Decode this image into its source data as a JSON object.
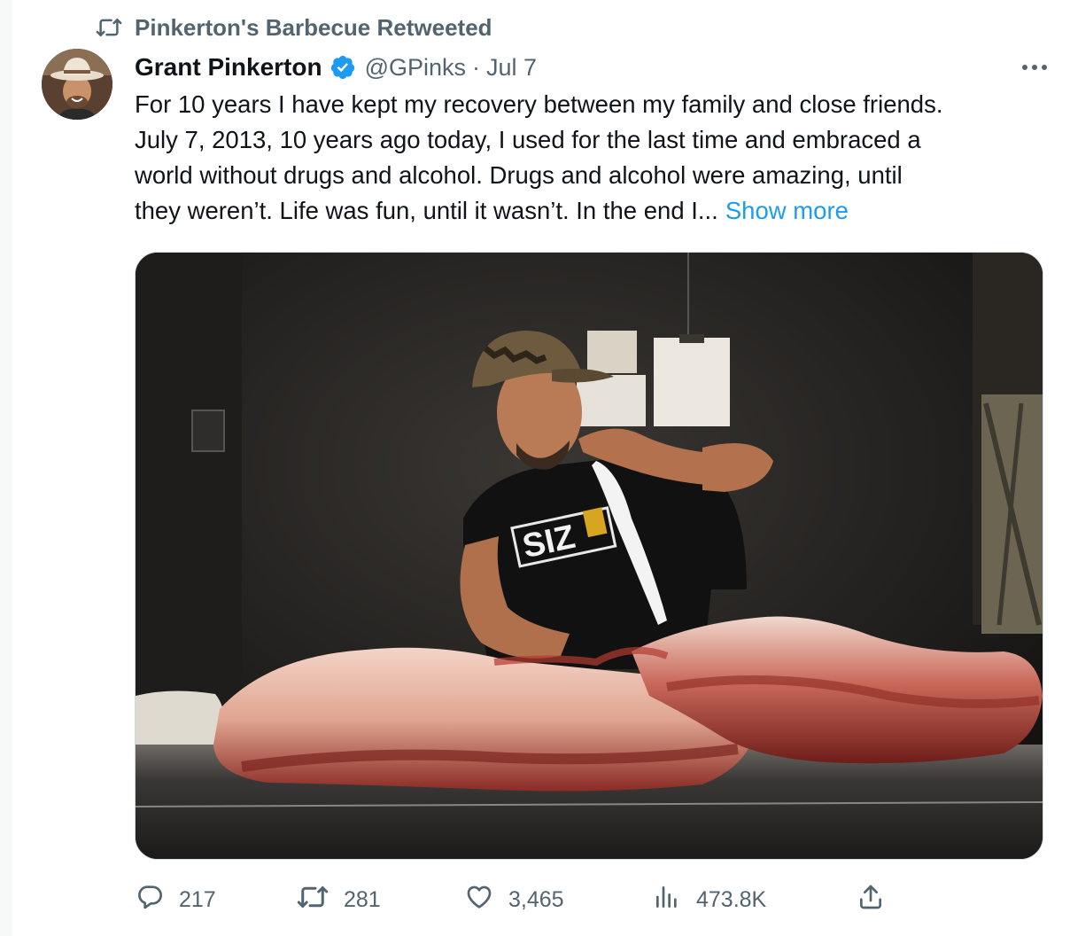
{
  "retweet_banner": {
    "text": "Pinkerton's Barbecue Retweeted",
    "icon": "retweet-icon"
  },
  "author": {
    "name": "Grant Pinkerton",
    "verified": true,
    "handle": "@GPinks",
    "separator": "·",
    "date": "Jul 7"
  },
  "tweet": {
    "lines": [
      "For 10 years I have kept my recovery between my family and close friends.",
      "July 7, 2013, 10 years ago today, I used for the last time and embraced a",
      "world without drugs and alcohol.  Drugs and alcohol were amazing, until",
      "they weren’t. Life was fun, until it wasn’t. In the end I..."
    ],
    "show_more": "Show more"
  },
  "media": {
    "shirt_text": "SIZ"
  },
  "actions": {
    "replies": "217",
    "retweets": "281",
    "likes": "3,465",
    "views": "473.8K"
  },
  "colors": {
    "link": "#1d9bf0",
    "muted": "#536471",
    "verified": "#1d9bf0"
  }
}
